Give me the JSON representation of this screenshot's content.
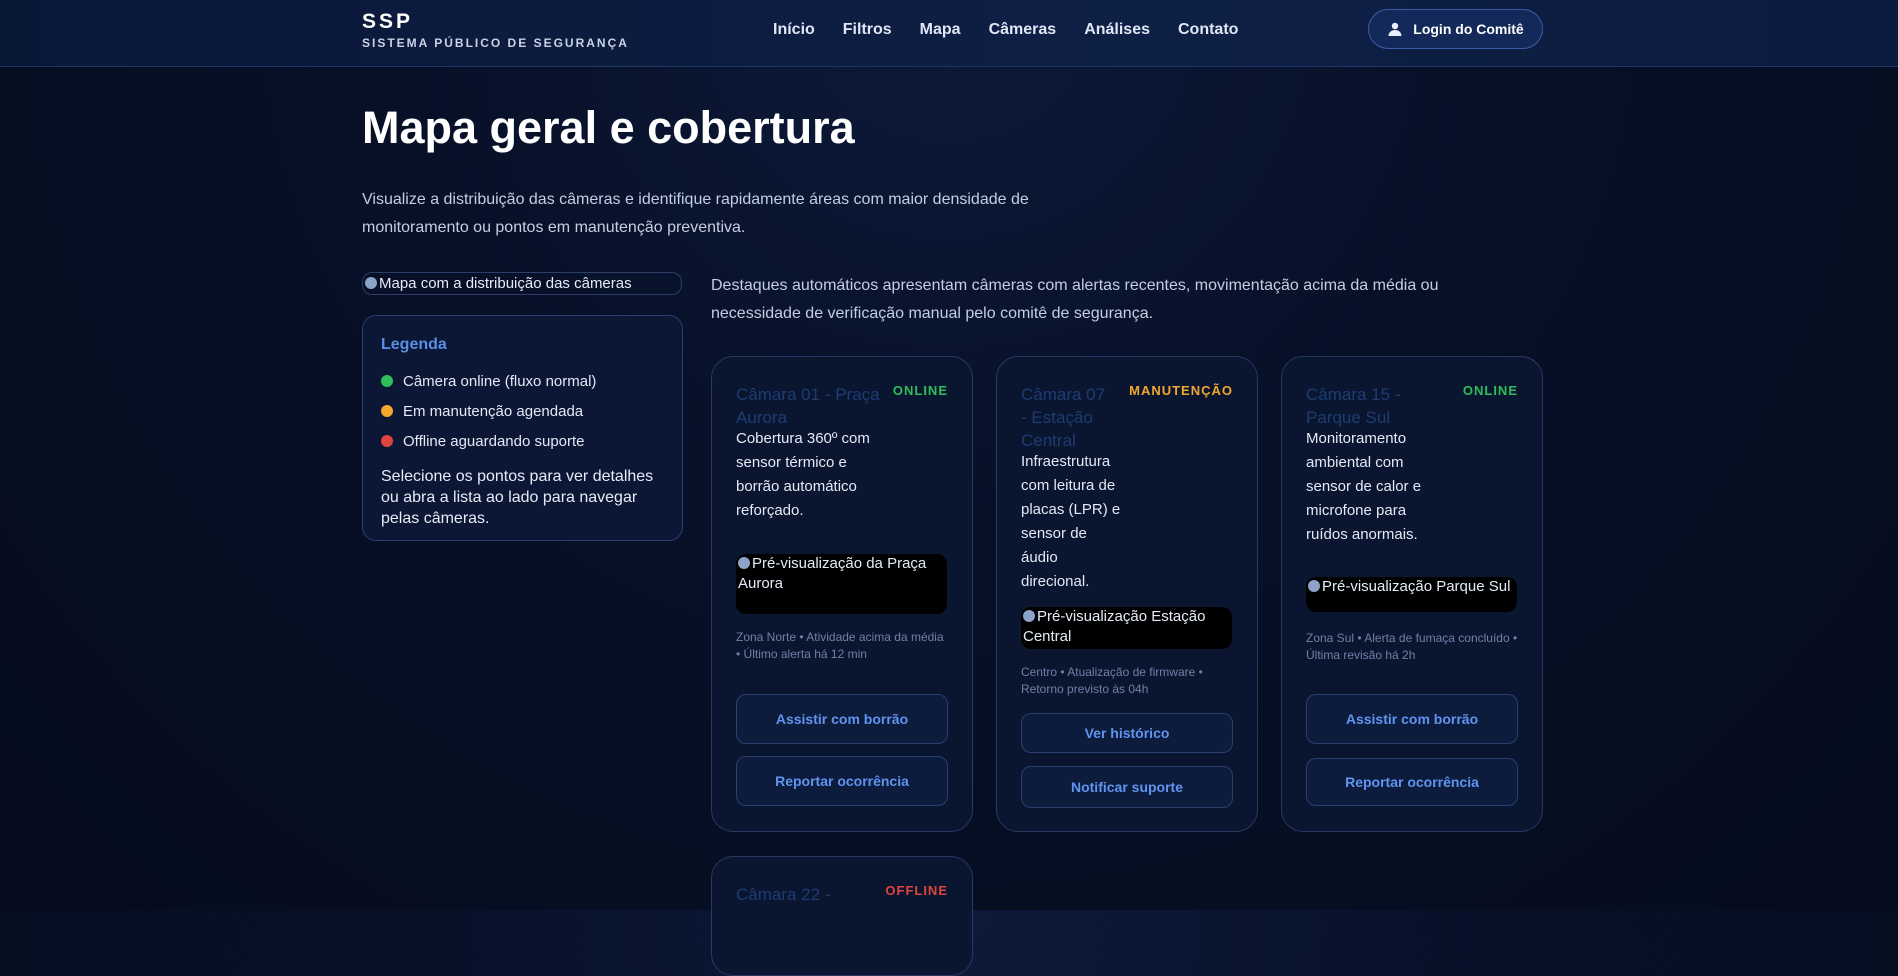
{
  "header": {
    "brand_title": "SSP",
    "brand_subtitle": "SISTEMA PÚBLICO DE SEGURANÇA",
    "nav": [
      "Início",
      "Filtros",
      "Mapa",
      "Câmeras",
      "Análises",
      "Contato"
    ],
    "login_label": "Login do Comitê"
  },
  "page": {
    "title": "Mapa geral e cobertura",
    "intro": "Visualize a distribuição das câmeras e identifique rapidamente áreas com maior densidade de monitoramento ou pontos em manutenção preventiva."
  },
  "map": {
    "alt": "Mapa com a distribuição das câmeras"
  },
  "legend": {
    "title": "Legenda",
    "items": [
      {
        "label": "Câmera online (fluxo normal)",
        "color": "#2fbe5a"
      },
      {
        "label": "Em manutenção agendada",
        "color": "#f2a82a"
      },
      {
        "label": "Offline aguardando suporte",
        "color": "#e0443e"
      }
    ],
    "note": "Selecione os pontos para ver detalhes ou abra a lista ao lado para navegar pelas câmeras."
  },
  "highlights": {
    "text": "Destaques automáticos apresentam câmeras com alertas recentes, movimentação acima da média ou necessidade de verificação manual pelo comitê de segurança."
  },
  "colors": {
    "online": "#2fbe5a",
    "maintenance": "#f2a82a",
    "offline": "#e0443e"
  },
  "cards": [
    {
      "title": "Câmara 01 - Praça Aurora",
      "status": "ONLINE",
      "description": "Cobertura 360º com sensor térmico e borrão automático reforçado.",
      "preview_alt": "Pré-visualização da Praça Aurora",
      "meta": "Zona Norte • Atividade acima da média • Último alerta há 12 min",
      "buttons": [
        "Assistir com borrão",
        "Reportar ocorrência"
      ]
    },
    {
      "title": "Câmara 07 - Estação Central",
      "status": "MANUTENÇÃO",
      "description": "Infraestrutura com leitura de placas (LPR) e sensor de áudio direcional.",
      "preview_alt": "Pré-visualização Estação Central",
      "meta": "Centro • Atualização de firmware • Retorno previsto às 04h",
      "buttons": [
        "Ver histórico",
        "Notificar suporte"
      ]
    },
    {
      "title": "Câmara 15 - Parque Sul",
      "status": "ONLINE",
      "description": "Monitoramento ambiental com sensor de calor e microfone para ruídos anormais.",
      "preview_alt": "Pré-visualização Parque Sul",
      "meta": "Zona Sul • Alerta de fumaça concluído • Última revisão há 2h",
      "buttons": [
        "Assistir com borrão",
        "Reportar ocorrência"
      ]
    },
    {
      "title": "Câmara 22 -",
      "status": "OFFLINE"
    }
  ]
}
